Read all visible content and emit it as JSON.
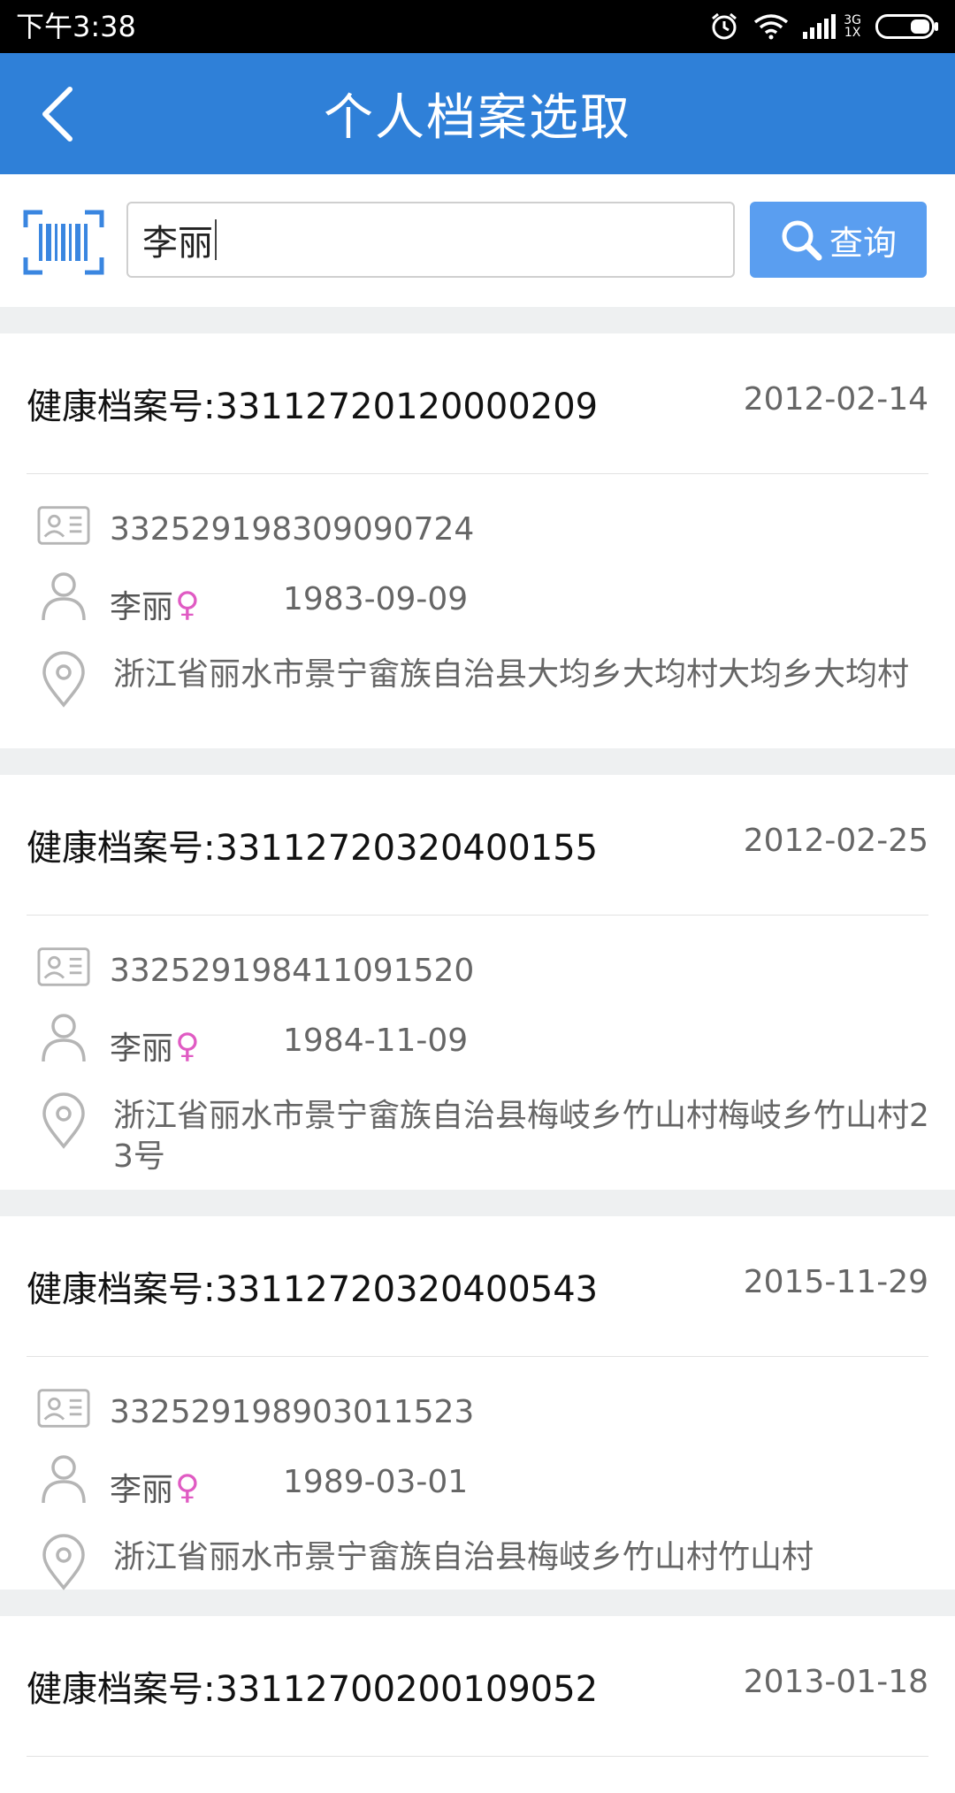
{
  "status_bar": {
    "time": "下午3:38",
    "network_top": "3G",
    "network_bottom": "1X"
  },
  "header": {
    "title": "个人档案选取"
  },
  "search": {
    "value": "李丽",
    "button_label": "查询"
  },
  "records": [
    {
      "label": "健康档案号:33112720120000209",
      "date": "2012-02-14",
      "id_number": "332529198309090724",
      "name": "李丽",
      "gender_symbol": "♀",
      "birth": "1983-09-09",
      "address": "浙江省丽水市景宁畲族自治县大均乡大均村大均乡大均村"
    },
    {
      "label": "健康档案号:33112720320400155",
      "date": "2012-02-25",
      "id_number": "332529198411091520",
      "name": "李丽",
      "gender_symbol": "♀",
      "birth": "1984-11-09",
      "address": "浙江省丽水市景宁畲族自治县梅岐乡竹山村梅岐乡竹山村23号"
    },
    {
      "label": "健康档案号:33112720320400543",
      "date": "2015-11-29",
      "id_number": "332529198903011523",
      "name": "李丽",
      "gender_symbol": "♀",
      "birth": "1989-03-01",
      "address": "浙江省丽水市景宁畲族自治县梅岐乡竹山村竹山村"
    },
    {
      "label": "健康档案号:33112700200109052",
      "date": "2013-01-18"
    }
  ],
  "colors": {
    "app_bar": "#2f80d8",
    "query_button": "#5a9ef0",
    "female_symbol": "#e05bc3",
    "separator": "#eef0f1"
  }
}
